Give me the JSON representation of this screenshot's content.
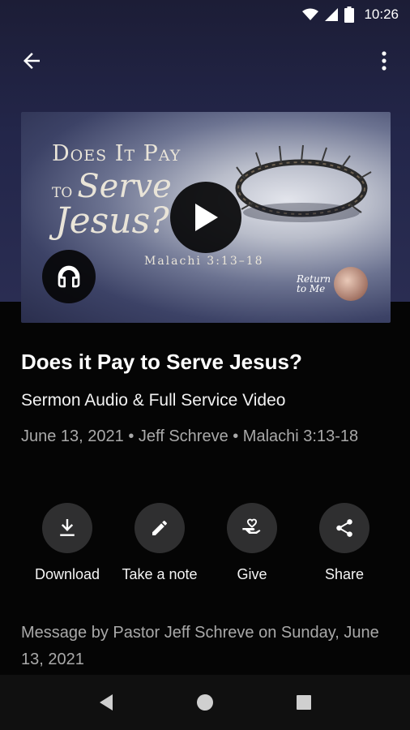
{
  "status_bar": {
    "time": "10:26"
  },
  "hero": {
    "art_title_line1": "Does It Pay",
    "art_title_to": "to",
    "art_title_line2": "Serve",
    "art_title_line3": "Jesus?",
    "art_reference": "Malachi 3:13–18",
    "series_logo_line1": "Return",
    "series_logo_line2": "to Me"
  },
  "sermon": {
    "title": "Does it Pay to Serve Jesus?",
    "subtitle": "Sermon Audio & Full Service Video",
    "meta": "June 13, 2021 • Jeff Schreve • Malachi 3:13-18",
    "message": "Message by Pastor Jeff Schreve on Sunday, June 13, 2021"
  },
  "actions": [
    {
      "label": "Download",
      "icon": "download-icon"
    },
    {
      "label": "Take a note",
      "icon": "pencil-icon"
    },
    {
      "label": "Give",
      "icon": "give-heart-hand-icon"
    },
    {
      "label": "Share",
      "icon": "share-icon"
    }
  ],
  "colors": {
    "background": "#050505",
    "header_gradient": "#23264a",
    "action_circle": "#2f2f30",
    "secondary_text": "#a9a9a9"
  }
}
